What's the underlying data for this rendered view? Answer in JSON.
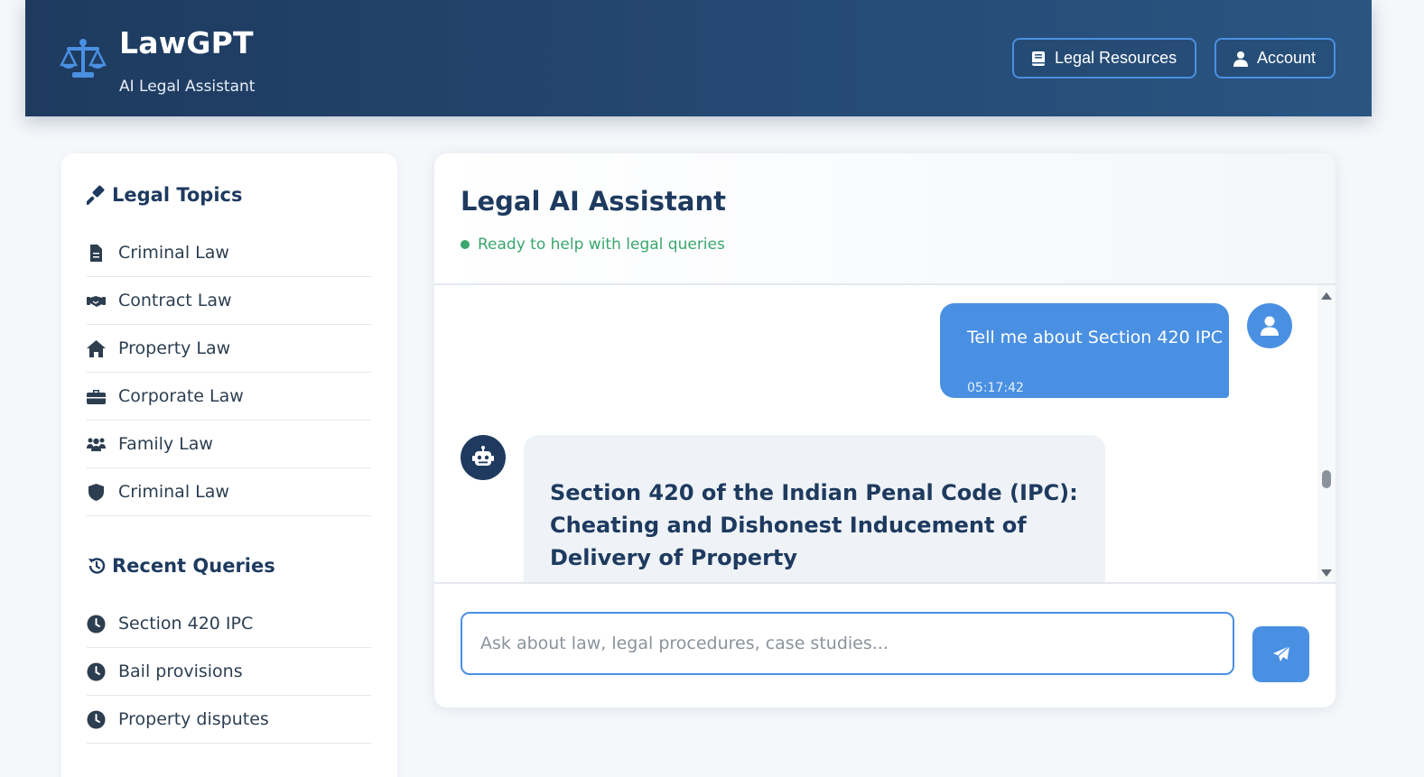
{
  "header": {
    "brand_title": "LawGPT",
    "brand_subtitle": "AI Legal Assistant",
    "logo_icon": "balance-scale-icon",
    "buttons": [
      {
        "label": "Legal Resources",
        "icon": "book-icon"
      },
      {
        "label": "Account",
        "icon": "user-icon"
      }
    ]
  },
  "sidebar": {
    "topics_heading": "Legal Topics",
    "topics_icon": "gavel-icon",
    "topics": [
      {
        "label": "Criminal Law",
        "icon": "file-icon"
      },
      {
        "label": "Contract Law",
        "icon": "handshake-icon"
      },
      {
        "label": "Property Law",
        "icon": "home-icon"
      },
      {
        "label": "Corporate Law",
        "icon": "briefcase-icon"
      },
      {
        "label": "Family Law",
        "icon": "users-icon"
      },
      {
        "label": "Criminal Law",
        "icon": "shield-icon"
      }
    ],
    "recent_heading": "Recent Queries",
    "recent_icon": "history-icon",
    "recent": [
      {
        "label": "Section 420 IPC",
        "icon": "clock-icon"
      },
      {
        "label": "Bail provisions",
        "icon": "clock-icon"
      },
      {
        "label": "Property disputes",
        "icon": "clock-icon"
      }
    ]
  },
  "chat": {
    "title": "Legal AI Assistant",
    "status": "Ready to help with legal queries",
    "messages": [
      {
        "role": "user",
        "text": "Tell me about Section 420 IPC",
        "time": "05:17:42"
      },
      {
        "role": "bot",
        "heading": "Section 420 of the Indian Penal Code (IPC): Cheating and Dishonest Inducement of Delivery of Property"
      }
    ],
    "input_placeholder": "Ask about law, legal procedures, case studies...",
    "input_value": "",
    "send_icon": "paper-plane-icon"
  },
  "colors": {
    "header_dark": "#1e3a5f",
    "accent": "#4a90e2",
    "status_green": "#3aa76d",
    "bot_bubble": "#eff3f7"
  }
}
